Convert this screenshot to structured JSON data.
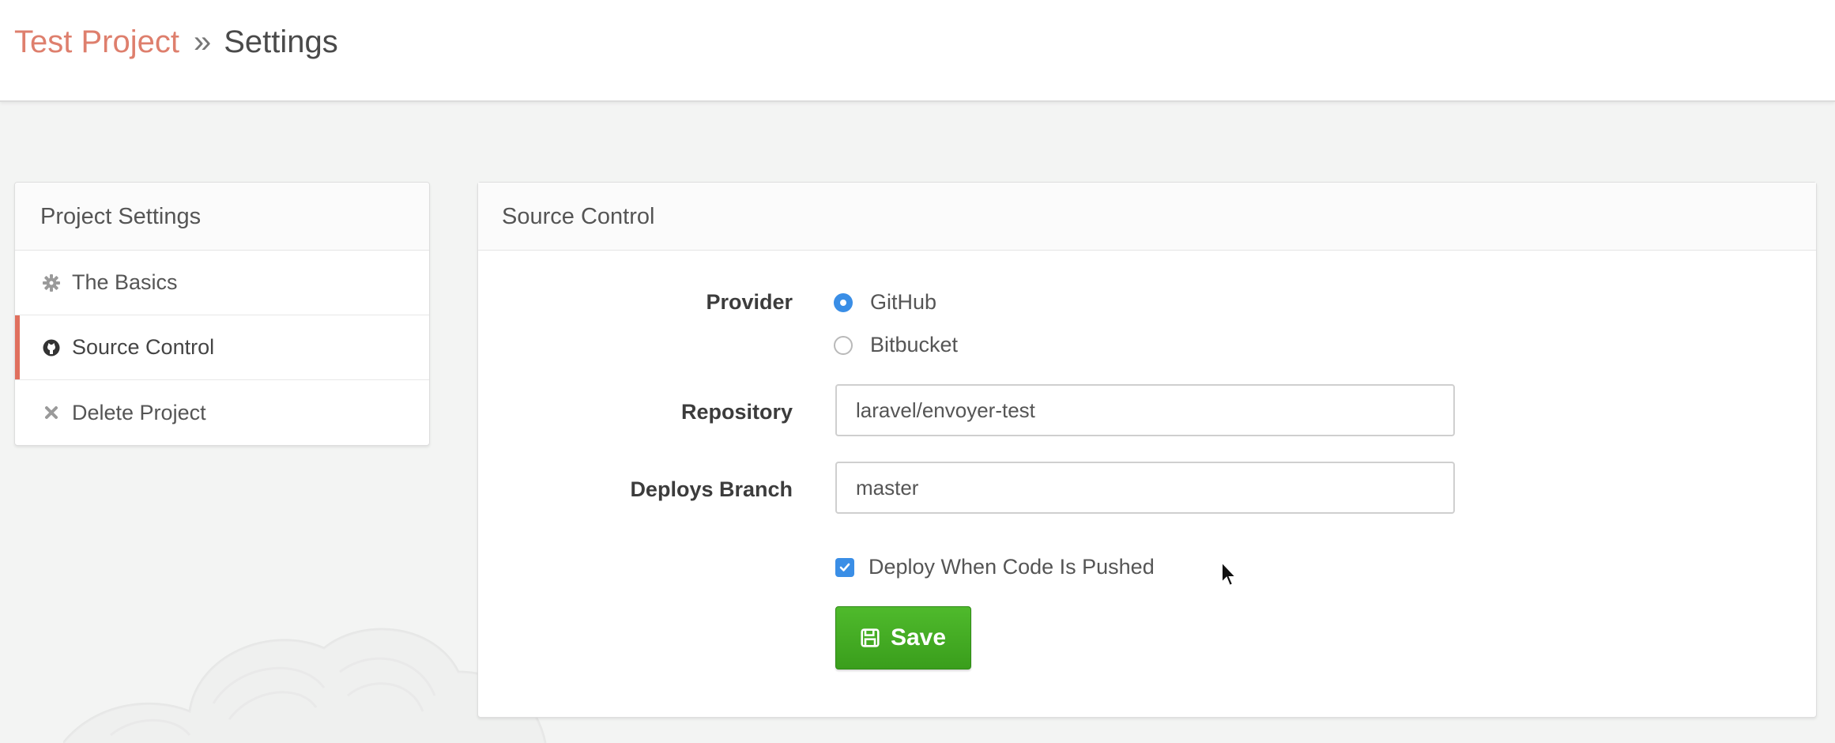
{
  "breadcrumb": {
    "project": "Test Project",
    "separator": "»",
    "current": "Settings"
  },
  "sidebar": {
    "title": "Project Settings",
    "items": [
      {
        "label": "The Basics",
        "icon": "gear-icon",
        "active": false
      },
      {
        "label": "Source Control",
        "icon": "github-icon",
        "active": true
      },
      {
        "label": "Delete Project",
        "icon": "close-icon",
        "active": false
      }
    ]
  },
  "main": {
    "title": "Source Control",
    "provider": {
      "label": "Provider",
      "options": [
        {
          "label": "GitHub",
          "selected": true
        },
        {
          "label": "Bitbucket",
          "selected": false
        }
      ]
    },
    "repository": {
      "label": "Repository",
      "value": "laravel/envoyer-test"
    },
    "branch": {
      "label": "Deploys Branch",
      "value": "master"
    },
    "deploy_on_push": {
      "label": "Deploy When Code Is Pushed",
      "checked": true
    },
    "save_label": "Save"
  },
  "colors": {
    "accent_link": "#de7f6d",
    "active_indicator": "#e0705e",
    "control_blue": "#3a8ee6",
    "save_green": "#43ab22"
  }
}
